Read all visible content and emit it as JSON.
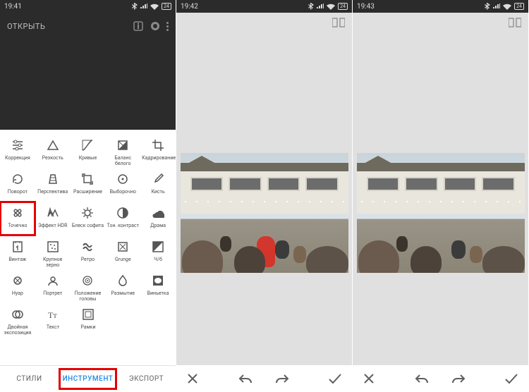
{
  "status": {
    "time1": "19:41",
    "time2": "19:42",
    "time3": "19:43",
    "battery": "24"
  },
  "panel1": {
    "open_label": "ОТКРЫТЬ",
    "tabs": {
      "styles": "СТИЛИ",
      "tools": "ИНСТРУМЕНТ",
      "export": "ЭКСПОРТ"
    }
  },
  "tools": {
    "r0": [
      {
        "label": "Коррекция",
        "icon": "sliders"
      },
      {
        "label": "Резкость",
        "icon": "triangle"
      },
      {
        "label": "Кривые",
        "icon": "curves"
      },
      {
        "label": "Баланс белого",
        "icon": "wb"
      },
      {
        "label": "Кадрирование",
        "icon": "crop"
      }
    ],
    "r1": [
      {
        "label": "Поворот",
        "icon": "rotate"
      },
      {
        "label": "Перспектива",
        "icon": "persp"
      },
      {
        "label": "Расширение",
        "icon": "expand"
      },
      {
        "label": "Выборочно",
        "icon": "target"
      },
      {
        "label": "Кисть",
        "icon": "brush"
      }
    ],
    "r2": [
      {
        "label": "Точечно",
        "icon": "healing",
        "highlight": true
      },
      {
        "label": "Эффект HDR",
        "icon": "hdr"
      },
      {
        "label": "Блеск софита",
        "icon": "glamour"
      },
      {
        "label": "Тон. контраст",
        "icon": "tonal"
      },
      {
        "label": "Драма",
        "icon": "drama"
      }
    ],
    "r3": [
      {
        "label": "Винтаж",
        "icon": "vintage"
      },
      {
        "label": "Крупное зерно",
        "icon": "grain"
      },
      {
        "label": "Ретро",
        "icon": "retro"
      },
      {
        "label": "Grunge",
        "icon": "grunge"
      },
      {
        "label": "Ч/б",
        "icon": "bw"
      }
    ],
    "r4": [
      {
        "label": "Нуар",
        "icon": "noir"
      },
      {
        "label": "Портрет",
        "icon": "portrait"
      },
      {
        "label": "Положение головы",
        "icon": "headpose"
      },
      {
        "label": "Размытие",
        "icon": "blur"
      },
      {
        "label": "Виньетка",
        "icon": "vignette"
      }
    ],
    "r5": [
      {
        "label": "Двойная экспозиция",
        "icon": "double"
      },
      {
        "label": "Текст",
        "icon": "text"
      },
      {
        "label": "Рамки",
        "icon": "frames"
      }
    ]
  }
}
